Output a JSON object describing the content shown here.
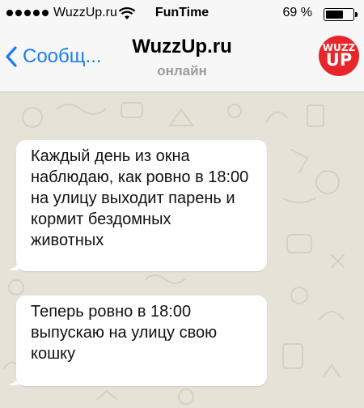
{
  "status_bar": {
    "carrier": "WuzzUp.ru",
    "time": "FunTime",
    "battery_percent": "69 %",
    "battery_level": 0.69,
    "icons": [
      "signal-dots-icon",
      "wifi-icon",
      "battery-icon"
    ]
  },
  "nav": {
    "back_label": "Сообщ...",
    "title": "WuzzUp.ru",
    "status": "онлайн",
    "avatar": {
      "line1": "WUZZ",
      "line2": "UP",
      "color": "#e8262a"
    },
    "accent_color": "#1a7cf5"
  },
  "messages": [
    {
      "lines": [
        "Каждый день из окна",
        "наблюдаю, как ровно в 18:00",
        "на улицу выходит парень и",
        "кормит бездомных",
        "животных"
      ]
    },
    {
      "lines": [
        "Теперь ровно в 18:00",
        "выпускаю на улицу свою",
        "кошку"
      ]
    }
  ]
}
